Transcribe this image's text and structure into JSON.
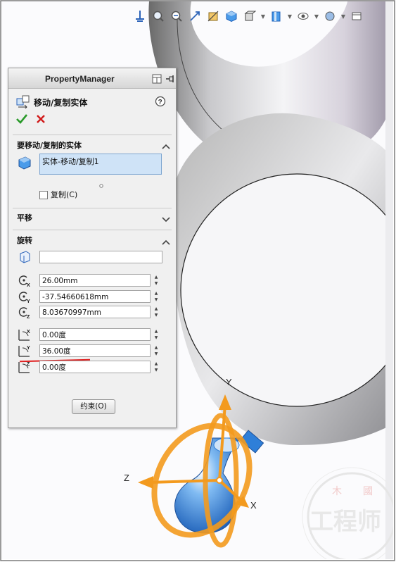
{
  "panel": {
    "title": "PropertyManager",
    "feature_name": "移动/复制实体",
    "help_icon": "question-icon",
    "ok_icon": "check-icon",
    "cancel_icon": "x-icon"
  },
  "bodies_section": {
    "title": "要移动/复制的实体",
    "selected_item": "实体-移动/复制1",
    "copy_checkbox_label": "复制(C)",
    "copy_checked": false
  },
  "translate_section": {
    "title": "平移",
    "expanded": false
  },
  "rotate_section": {
    "title": "旋转",
    "expanded": true,
    "reference_value": "",
    "origin_x": "26.00mm",
    "origin_y": "-37.54660618mm",
    "origin_z": "8.03670997mm",
    "angle_x": "0.00度",
    "angle_y": "36.00度",
    "angle_z": "0.00度"
  },
  "constraints_button": "约束(O)",
  "triad": {
    "axis_y_label": "Y",
    "axis_z_label": "Z",
    "axis_x_label": "X"
  },
  "colors": {
    "accent_orange": "#f39a1e",
    "selection_blue": "#cfe3f7",
    "annotation_red": "#e02020",
    "part_blue": "#2f7fd8"
  },
  "watermark": {
    "line1": "工程师",
    "stamp": "國"
  }
}
